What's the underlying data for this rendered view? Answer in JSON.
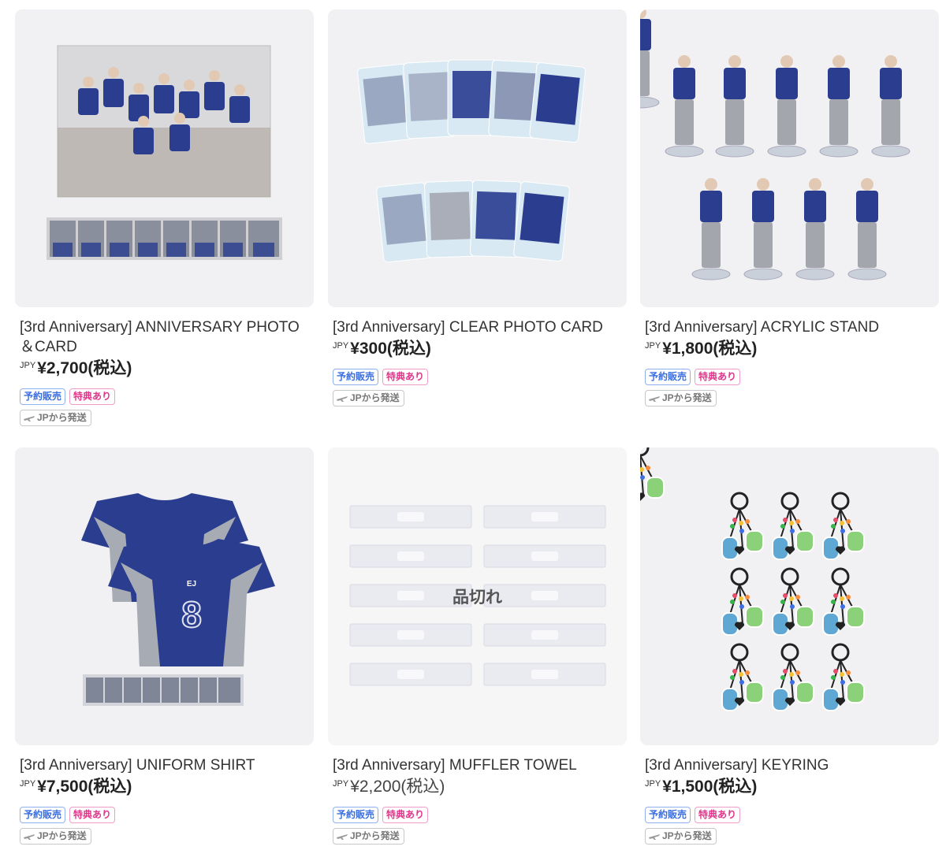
{
  "colors": {
    "thumb_bg": "#f1f1f3",
    "badge_preorder": "#3b6fe0",
    "badge_bonus": "#e0358a",
    "ship_badge": "#777777",
    "jersey_navy": "#2b3d8f",
    "jersey_gray": "#a7abb3"
  },
  "products": [
    {
      "title": "[3rd Anniversary] ANNIVERSARY PHOTO＆CARD",
      "currency": "JPY",
      "price": "¥2,700(税込)",
      "badges": [
        "予約販売",
        "特典あり"
      ],
      "shipping": "JPから発送",
      "sold_out": "",
      "image_icon": "photo-card-icon"
    },
    {
      "title": "[3rd Anniversary] CLEAR PHOTO CARD",
      "currency": "JPY",
      "price": "¥300(税込)",
      "badges": [
        "予約販売",
        "特典あり"
      ],
      "shipping": "JPから発送",
      "sold_out": "",
      "image_icon": "clear-card-icon"
    },
    {
      "title": "[3rd Anniversary] ACRYLIC STAND",
      "currency": "JPY",
      "price": "¥1,800(税込)",
      "badges": [
        "予約販売",
        "特典あり"
      ],
      "shipping": "JPから発送",
      "sold_out": "",
      "image_icon": "acrylic-stand-icon"
    },
    {
      "title": "[3rd Anniversary] UNIFORM SHIRT",
      "currency": "JPY",
      "price": "¥7,500(税込)",
      "badges": [
        "予約販売",
        "特典あり"
      ],
      "shipping": "JPから発送",
      "sold_out": "",
      "image_icon": "shirt-icon"
    },
    {
      "title": "[3rd Anniversary] MUFFLER TOWEL",
      "currency": "JPY",
      "price": "¥2,200(税込)",
      "badges": [
        "予約販売",
        "特典あり"
      ],
      "shipping": "JPから発送",
      "sold_out": "品切れ",
      "image_icon": "towel-icon"
    },
    {
      "title": "[3rd Anniversary] KEYRING",
      "currency": "JPY",
      "price": "¥1,500(税込)",
      "badges": [
        "予約販売",
        "特典あり"
      ],
      "shipping": "JPから発送",
      "sold_out": "",
      "image_icon": "keyring-icon"
    }
  ]
}
